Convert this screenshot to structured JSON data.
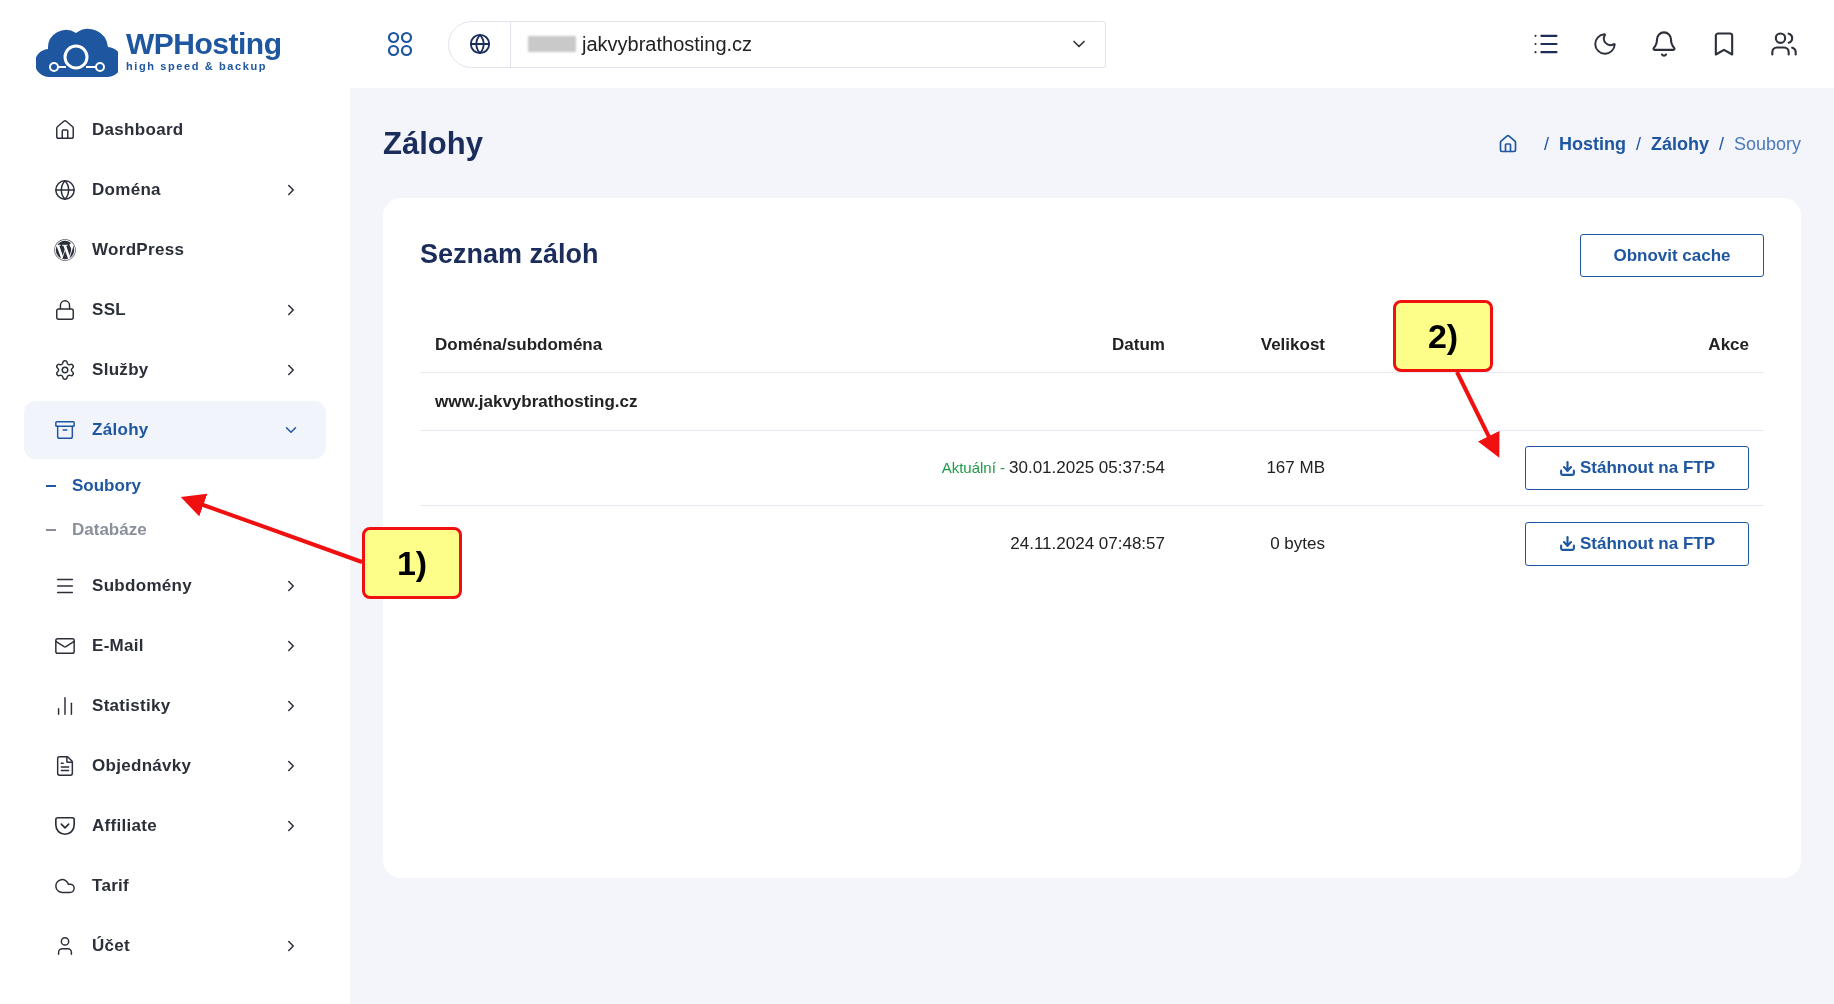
{
  "logo": {
    "name": "WPHosting",
    "tagline": "high speed & backup"
  },
  "domain_select": {
    "value": "jakvybrathosting.cz"
  },
  "sidebar": {
    "items": [
      {
        "label": "Dashboard",
        "has_submenu": false,
        "selected": false
      },
      {
        "label": "Doména",
        "has_submenu": true,
        "expanded": false,
        "selected": false
      },
      {
        "label": "WordPress",
        "has_submenu": false,
        "selected": false
      },
      {
        "label": "SSL",
        "has_submenu": true,
        "expanded": false,
        "selected": false
      },
      {
        "label": "Služby",
        "has_submenu": true,
        "expanded": false,
        "selected": false
      },
      {
        "label": "Zálohy",
        "has_submenu": true,
        "expanded": true,
        "selected": true,
        "children": [
          {
            "label": "Soubory",
            "selected": true
          },
          {
            "label": "Databáze",
            "selected": false
          }
        ]
      },
      {
        "label": "Subdomény",
        "has_submenu": true,
        "expanded": false,
        "selected": false
      },
      {
        "label": "E-Mail",
        "has_submenu": true,
        "expanded": false,
        "selected": false
      },
      {
        "label": "Statistiky",
        "has_submenu": true,
        "expanded": false,
        "selected": false
      },
      {
        "label": "Objednávky",
        "has_submenu": true,
        "expanded": false,
        "selected": false
      },
      {
        "label": "Affiliate",
        "has_submenu": true,
        "expanded": false,
        "selected": false
      },
      {
        "label": "Tarif",
        "has_submenu": false,
        "selected": false
      },
      {
        "label": "Účet",
        "has_submenu": true,
        "expanded": false,
        "selected": false
      }
    ]
  },
  "page_title": "Zálohy",
  "breadcrumb": [
    {
      "separator": "/",
      "label": "Hosting",
      "current": false
    },
    {
      "separator": "/",
      "label": "Zálohy",
      "current": false
    },
    {
      "separator": "/",
      "label": "Soubory",
      "current": true
    }
  ],
  "card": {
    "title": "Seznam záloh",
    "refresh_button": "Obnovit cache",
    "table": {
      "columns": [
        "Doména/subdoména",
        "Datum",
        "Velikost",
        "Akce"
      ],
      "group": "www.jakvybrathosting.cz",
      "rows": [
        {
          "badge": "Aktuální -",
          "date": "30.01.2025 05:37:54",
          "size": "167 MB",
          "action": "Stáhnout na FTP"
        },
        {
          "date": "24.11.2024 07:48:57",
          "size": "0 bytes",
          "action": "Stáhnout na FTP"
        }
      ]
    }
  },
  "annotations": [
    {
      "label": "1)"
    },
    {
      "label": "2)"
    }
  ]
}
